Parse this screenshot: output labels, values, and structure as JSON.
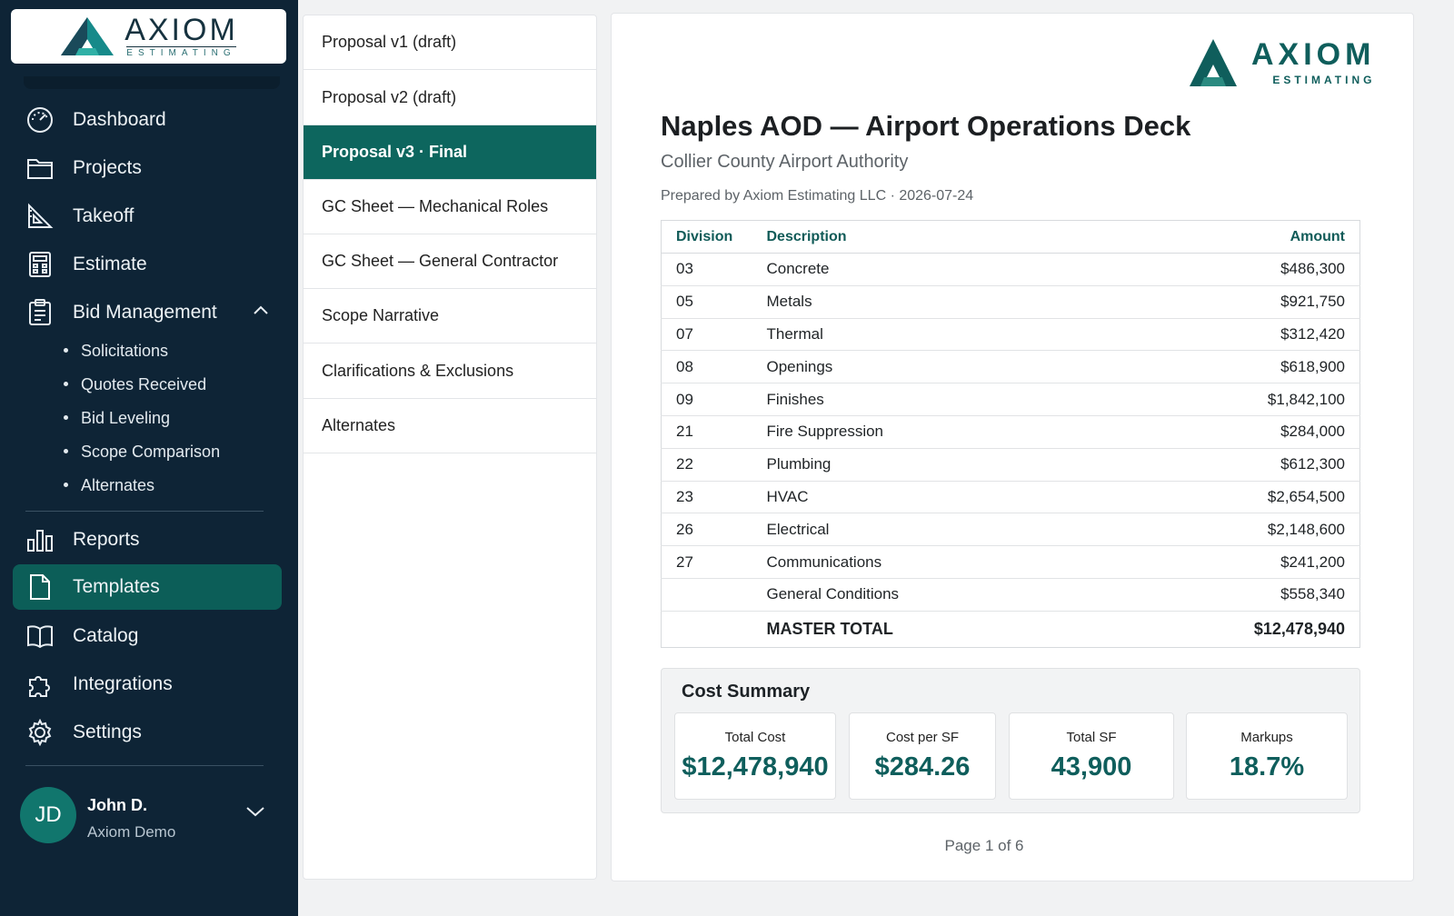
{
  "brand": {
    "name": "AXIOM",
    "tagline": "ESTIMATING"
  },
  "sidebar": {
    "nav": [
      {
        "label": "Dashboard",
        "icon": "dashboard-gauge-icon"
      },
      {
        "label": "Projects",
        "icon": "folder-icon"
      },
      {
        "label": "Takeoff",
        "icon": "ruler-triangle-icon"
      },
      {
        "label": "Estimate",
        "icon": "calculator-icon"
      },
      {
        "label": "Bid Management",
        "icon": "clipboard-icon",
        "expanded": true
      },
      {
        "label": "Reports",
        "icon": "bar-chart-icon"
      },
      {
        "label": "Templates",
        "icon": "document-icon",
        "active": true
      },
      {
        "label": "Catalog",
        "icon": "book-icon"
      },
      {
        "label": "Integrations",
        "icon": "puzzle-icon"
      },
      {
        "label": "Settings",
        "icon": "gear-icon"
      }
    ],
    "bid_subitems": [
      "Solicitations",
      "Quotes Received",
      "Bid Leveling",
      "Scope Comparison",
      "Alternates"
    ],
    "user": {
      "initials": "JD",
      "name": "John D.",
      "org": "Axiom Demo"
    }
  },
  "doc_list": [
    "Proposal v1 (draft)",
    "Proposal v2 (draft)",
    "Proposal v3 · Final",
    "GC Sheet — Mechanical Roles",
    "GC Sheet — General Contractor",
    "Scope Narrative",
    "Clarifications & Exclusions",
    "Alternates"
  ],
  "doc_list_active_index": 2,
  "preview": {
    "title": "Naples AOD — Airport Operations Deck",
    "client": "Collier County Airport Authority",
    "prepared": "Prepared by Axiom Estimating LLC · 2026-07-24",
    "table": {
      "headers": [
        "Division",
        "Description",
        "Amount"
      ],
      "rows": [
        [
          "03",
          "Concrete",
          "$486,300"
        ],
        [
          "05",
          "Metals",
          "$921,750"
        ],
        [
          "07",
          "Thermal",
          "$312,420"
        ],
        [
          "08",
          "Openings",
          "$618,900"
        ],
        [
          "09",
          "Finishes",
          "$1,842,100"
        ],
        [
          "21",
          "Fire Suppression",
          "$284,000"
        ],
        [
          "22",
          "Plumbing",
          "$612,300"
        ],
        [
          "23",
          "HVAC",
          "$2,654,500"
        ],
        [
          "26",
          "Electrical",
          "$2,148,600"
        ],
        [
          "27",
          "Communications",
          "$241,200"
        ],
        [
          "",
          "General Conditions",
          "$558,340"
        ]
      ],
      "total": {
        "label": "MASTER TOTAL",
        "amount": "$12,478,940"
      }
    },
    "summary": {
      "title": "Cost Summary",
      "cards": [
        {
          "label": "Total Cost",
          "value": "$12,478,940"
        },
        {
          "label": "Cost per SF",
          "value": "$284.26"
        },
        {
          "label": "Total SF",
          "value": "43,900"
        },
        {
          "label": "Markups",
          "value": "18.7%"
        }
      ]
    },
    "page": "Page 1 of 6"
  },
  "colors": {
    "sidebar_bg": "#0e2436",
    "accent": "#0d665e",
    "teal_text": "#0f5e5c"
  }
}
